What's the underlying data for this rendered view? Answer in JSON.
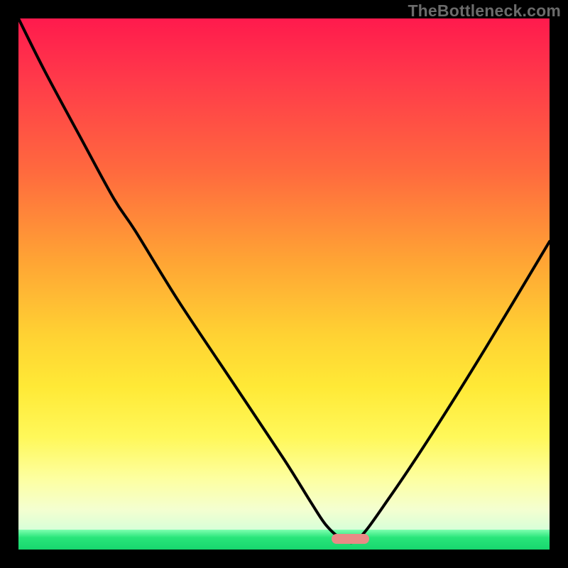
{
  "watermark": "TheBottleneck.com",
  "colors": {
    "frame": "#000000",
    "gradient_top": "#ff1a4d",
    "gradient_mid": "#ffd233",
    "gradient_bottom": "#fdffa0",
    "green": "#18d66e",
    "curve": "#000000",
    "marker": "#e98b86"
  },
  "chart_data": {
    "type": "line",
    "title": "",
    "xlabel": "",
    "ylabel": "",
    "xlim": [
      0,
      100
    ],
    "ylim": [
      0,
      100
    ],
    "series": [
      {
        "name": "bottleneck-curve",
        "x": [
          0,
          5,
          12,
          18,
          22,
          30,
          40,
          50,
          55,
          58,
          61,
          64,
          70,
          78,
          88,
          100
        ],
        "values": [
          100,
          90,
          77,
          66,
          60,
          47,
          32,
          17,
          9,
          4.5,
          2,
          2,
          10,
          22,
          38,
          58
        ]
      }
    ],
    "marker": {
      "x_start": 59,
      "x_end": 66,
      "y": 2
    },
    "annotations": []
  }
}
